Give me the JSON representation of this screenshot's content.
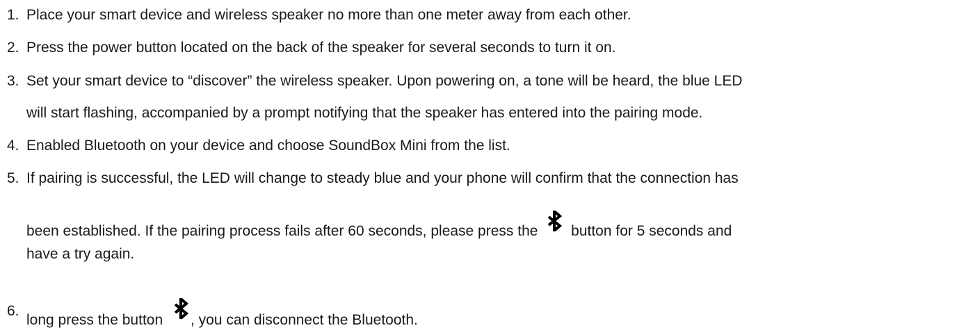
{
  "steps": [
    {
      "number": "1.",
      "lines": [
        "Place your smart device and wireless speaker no more than one meter away from each other."
      ]
    },
    {
      "number": "2.",
      "lines": [
        "Press the power button located on the back of the speaker for several seconds to turn it on."
      ]
    },
    {
      "number": "3.",
      "lines": [
        "Set your smart device to “discover” the wireless speaker. Upon powering on, a tone will be heard, the blue LED",
        "will start flashing, accompanied by a prompt notifying that the speaker has entered into the pairing mode."
      ]
    },
    {
      "number": "4.",
      "lines": [
        "Enabled Bluetooth on your device and choose SoundBox Mini from the list."
      ]
    },
    {
      "number": "5.",
      "lines": [
        "If pairing is successful, the LED will change to steady blue and your phone will confirm that the connection has",
        "been established. If the pairing process fails after 60 seconds, please press the",
        "button for 5 seconds and",
        "have a try again."
      ]
    },
    {
      "number": "6.",
      "lines": [
        "long press the button",
        ", you can disconnect the Bluetooth."
      ]
    }
  ],
  "icons": {
    "bluetooth": "bluetooth-icon"
  },
  "colors": {
    "text": "#1a1a1a",
    "icon": "#000000",
    "background": "#ffffff"
  }
}
